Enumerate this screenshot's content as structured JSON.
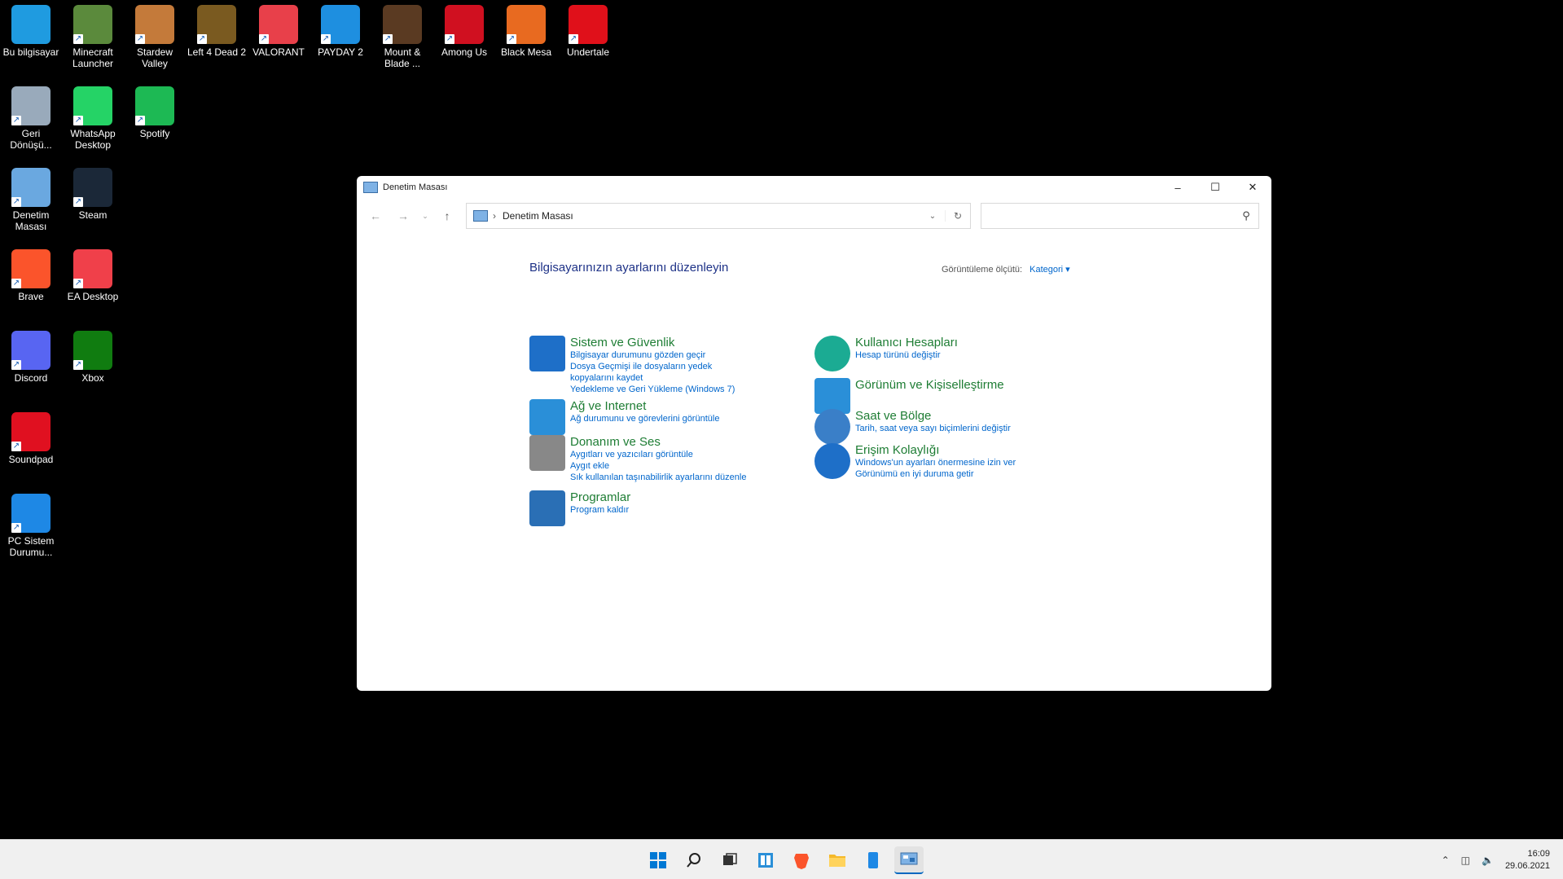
{
  "desktop": {
    "icons": [
      {
        "label": "Bu bilgisayar",
        "icon": "computer-icon",
        "color": "#1f9be0"
      },
      {
        "label": "Minecraft Launcher",
        "icon": "minecraft-icon",
        "color": "#5b8a3c"
      },
      {
        "label": "Stardew Valley",
        "icon": "stardew-icon",
        "color": "#c47a3a"
      },
      {
        "label": "Left 4 Dead 2",
        "icon": "l4d2-icon",
        "color": "#7a5a20"
      },
      {
        "label": "VALORANT",
        "icon": "valorant-icon",
        "color": "#e8404a"
      },
      {
        "label": "PAYDAY 2",
        "icon": "payday-icon",
        "color": "#1e8fe0"
      },
      {
        "label": "Mount & Blade ...",
        "icon": "mount-blade-icon",
        "color": "#5a3a22"
      },
      {
        "label": "Among Us",
        "icon": "among-us-icon",
        "color": "#d01020"
      },
      {
        "label": "Black Mesa",
        "icon": "black-mesa-icon",
        "color": "#e86a20"
      },
      {
        "label": "Undertale",
        "icon": "undertale-icon",
        "color": "#e0101a"
      },
      {
        "label": "Geri Dönüşü...",
        "icon": "recycle-bin-icon",
        "color": "#9ab"
      },
      {
        "label": "WhatsApp Desktop",
        "icon": "whatsapp-icon",
        "color": "#25d366"
      },
      {
        "label": "Spotify",
        "icon": "spotify-icon",
        "color": "#1db954"
      },
      {
        "label": "Denetim Masası",
        "icon": "control-panel-icon",
        "color": "#6aa8e0"
      },
      {
        "label": "Steam",
        "icon": "steam-icon",
        "color": "#1b2838"
      },
      {
        "label": "Brave",
        "icon": "brave-icon",
        "color": "#fb542b"
      },
      {
        "label": "EA Desktop",
        "icon": "ea-icon",
        "color": "#f0404a"
      },
      {
        "label": "Discord",
        "icon": "discord-icon",
        "color": "#5865f2"
      },
      {
        "label": "Xbox",
        "icon": "xbox-icon",
        "color": "#107c10"
      },
      {
        "label": "Soundpad",
        "icon": "soundpad-icon",
        "color": "#e01020"
      },
      {
        "label": "PC Sistem Durumu...",
        "icon": "pc-health-icon",
        "color": "#1e88e5"
      }
    ]
  },
  "window": {
    "title": "Denetim Masası",
    "address": "Denetim Masası",
    "search_placeholder": "",
    "heading": "Bilgisayarınızın ayarlarını düzenleyin",
    "view_by_label": "Görüntüleme ölçütü:",
    "view_by_value": "Kategori",
    "categories": [
      {
        "title": "Sistem ve Güvenlik",
        "links": [
          "Bilgisayar durumunu gözden geçir",
          "Dosya Geçmişi ile dosyaların yedek kopyalarını kaydet",
          "Yedekleme ve Geri Yükleme (Windows 7)"
        ]
      },
      {
        "title": "Ağ ve Internet",
        "links": [
          "Ağ durumunu ve görevlerini görüntüle"
        ]
      },
      {
        "title": "Donanım ve Ses",
        "links": [
          "Aygıtları ve yazıcıları görüntüle",
          "Aygıt ekle",
          "Sık kullanılan taşınabilirlik ayarlarını düzenle"
        ]
      },
      {
        "title": "Programlar",
        "links": [
          "Program kaldır"
        ]
      },
      {
        "title": "Kullanıcı Hesapları",
        "links": [
          "Hesap türünü değiştir"
        ]
      },
      {
        "title": "Görünüm ve Kişiselleştirme",
        "links": []
      },
      {
        "title": "Saat ve Bölge",
        "links": [
          "Tarih, saat veya sayı biçimlerini değiştir"
        ]
      },
      {
        "title": "Erişim Kolaylığı",
        "links": [
          "Windows'un ayarları önermesine izin ver",
          "Görünümü en iyi duruma getir"
        ]
      }
    ]
  },
  "taskbar": {
    "time": "16:09",
    "date": "29.06.2021"
  }
}
